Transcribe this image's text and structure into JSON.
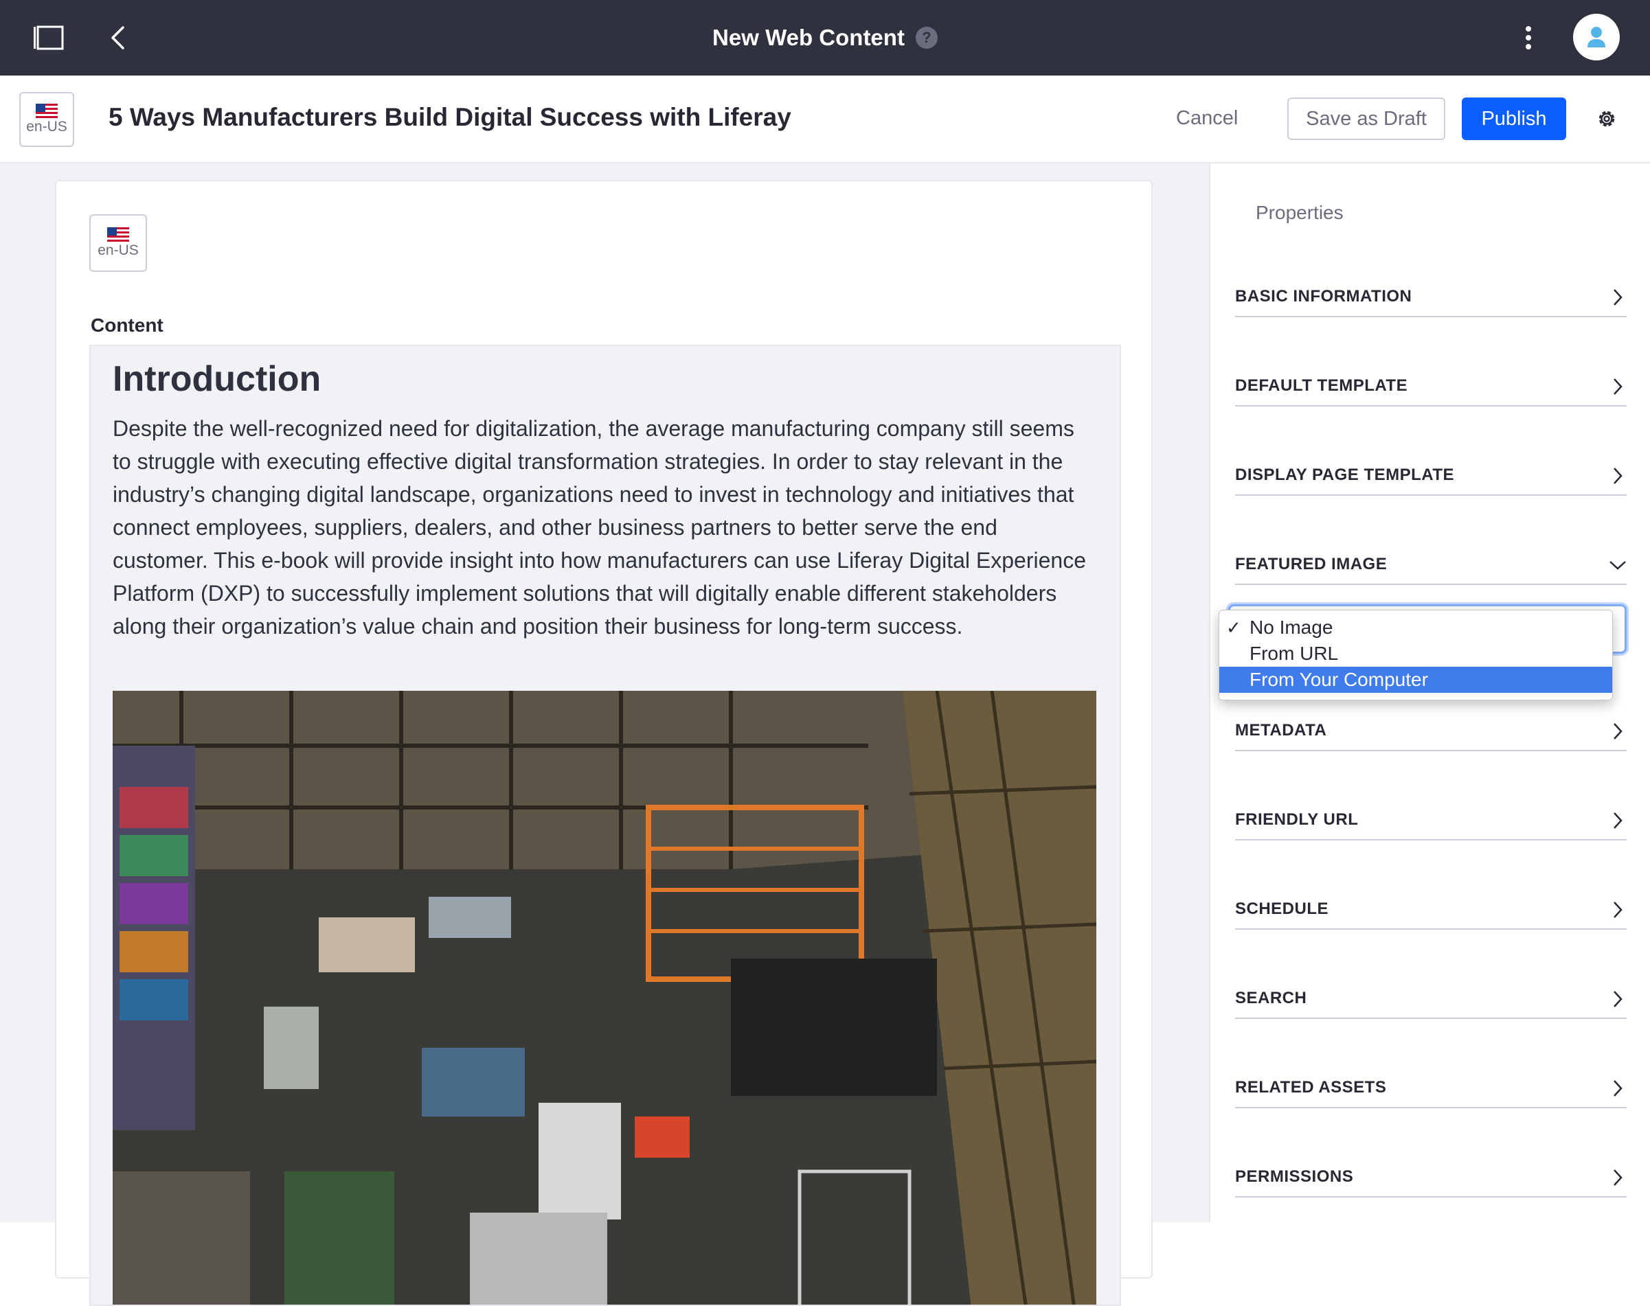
{
  "topbar": {
    "title": "New Web Content",
    "help_symbol": "?"
  },
  "header": {
    "locale": "en-US",
    "title": "5 Ways Manufacturers Build Digital Success with Liferay",
    "cancel_label": "Cancel",
    "save_draft_label": "Save as Draft",
    "publish_label": "Publish"
  },
  "editor": {
    "locale": "en-US",
    "content_label": "Content",
    "heading": "Introduction",
    "body": "Despite the well-recognized need for digitalization, the average manufacturing company still seems to struggle with executing effective digital transformation strategies. In order to stay relevant in the industry’s changing digital landscape, organizations need to invest in technology and initiatives that connect employees, suppliers, dealers, and other business partners to better serve the end customer. This e-book will provide insight into how manufacturers can use Liferay Digital Experience Platform (DXP) to successfully implement solutions that will digitally enable different stakeholders along their organization’s value chain and position their business for long-term success."
  },
  "sidebar": {
    "title": "Properties",
    "panels": [
      {
        "label": "BASIC INFORMATION",
        "state": "collapsed"
      },
      {
        "label": "DEFAULT TEMPLATE",
        "state": "collapsed"
      },
      {
        "label": "DISPLAY PAGE TEMPLATE",
        "state": "collapsed"
      },
      {
        "label": "FEATURED IMAGE",
        "state": "expanded"
      },
      {
        "label": "METADATA",
        "state": "collapsed"
      },
      {
        "label": "FRIENDLY URL",
        "state": "collapsed"
      },
      {
        "label": "SCHEDULE",
        "state": "collapsed"
      },
      {
        "label": "SEARCH",
        "state": "collapsed"
      },
      {
        "label": "RELATED ASSETS",
        "state": "collapsed"
      },
      {
        "label": "PERMISSIONS",
        "state": "collapsed"
      }
    ]
  },
  "featured_image_select": {
    "options": [
      "No Image",
      "From URL",
      "From Your Computer"
    ],
    "checked": "No Image",
    "highlighted": "From Your Computer"
  },
  "colors": {
    "topbar": "#30313f",
    "primary": "#0b5fff",
    "highlight": "#3f7bea"
  }
}
